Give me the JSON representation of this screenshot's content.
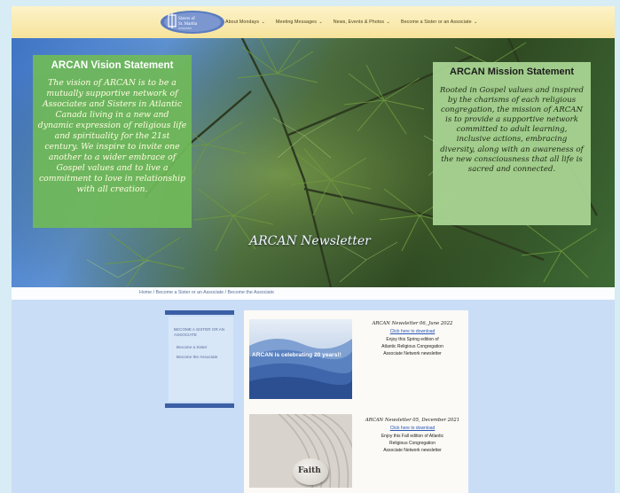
{
  "logo": {
    "line1": "Sisters of",
    "line2": "St. Martha",
    "line3": "ANTIGONISH"
  },
  "nav": {
    "items": [
      {
        "label": "About Mondays"
      },
      {
        "label": "Meeting Messages"
      },
      {
        "label": "News, Events & Photos"
      },
      {
        "label": "Become a Sister or an Associate"
      }
    ]
  },
  "hero": {
    "vision_title": "ARCAN Vision Statement",
    "vision_text": "The vision of ARCAN is to be a mutually supportive network of Associates and Sisters in Atlantic Canada living in a new and dynamic expression of religious life and spirituality for the 21st century. We inspire to invite one another to a wider embrace of Gospel values and to live a commitment to love in relationship with all creation.",
    "mission_title": "ARCAN Mission Statement",
    "mission_text": "Rooted in Gospel values and inspired by the charisms of each religious congregation, the mission of ARCAN is to provide a supportive network committed to adult learning, inclusive actions, embracing diversity, along with an awareness of the new consciousness that all life is sacred and connected.",
    "page_title": "ARCAN Newsletter"
  },
  "breadcrumb": "Home / Become a Sister or an Associate / Become the Associate",
  "sidebar": {
    "title": "Become a Sister or an Associate",
    "links": [
      "Become a Sister",
      "Become the Associate"
    ]
  },
  "newsletters": [
    {
      "title": "ARCAN Newsletter 06, June 2022",
      "download": "Click here to download",
      "desc_line1": "Enjoy this Spring edition of",
      "desc_line2": "Atlantic Religious Congregation",
      "desc_line3": "Associate Network newsletter",
      "image_caption": "ARCAN is celebrating 20 years!!"
    },
    {
      "title": "ARCAN Newsletter 05, December 2021",
      "download": "Click here to download",
      "desc_line1": "Enjoy this Fall edition of Atlantic",
      "desc_line2": "Religious Congregation",
      "desc_line3": "Associate Network newsletter",
      "image_caption": "Faith"
    }
  ],
  "colors": {
    "nav_bg": "#f6e39b",
    "vision_box": "#70ba58",
    "mission_box": "#aad694",
    "sidebar_accent": "#3c5fa6",
    "link": "#2a57b8",
    "page_bg": "#c9ddf6"
  }
}
